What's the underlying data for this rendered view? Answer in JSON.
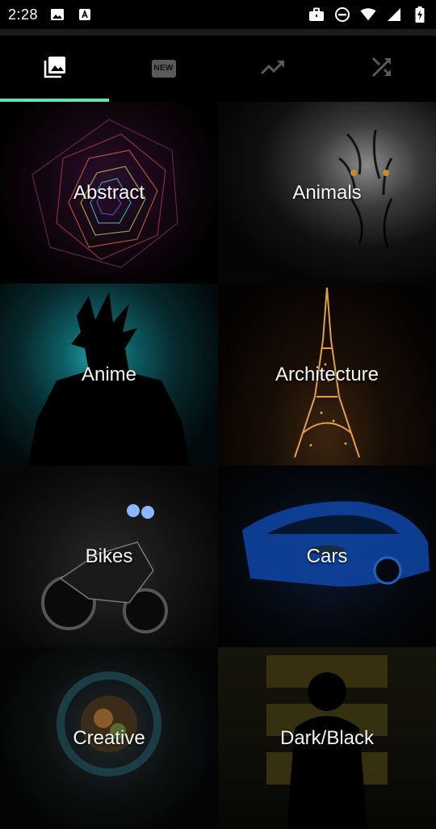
{
  "status_bar": {
    "time": "2:28",
    "icons": [
      "image-notification-icon",
      "a-notification-icon",
      "briefcase-icon",
      "do-not-disturb-icon",
      "wifi-icon",
      "cell-signal-icon",
      "battery-charging-icon"
    ]
  },
  "tabs": [
    {
      "name": "gallery-icon",
      "active": true
    },
    {
      "name": "new-icon",
      "active": false,
      "badge_text": "NEW"
    },
    {
      "name": "trending-icon",
      "active": false
    },
    {
      "name": "shuffle-icon",
      "active": false
    }
  ],
  "accent_color": "#5fe3b7",
  "categories": [
    {
      "label": "Abstract"
    },
    {
      "label": "Animals"
    },
    {
      "label": "Anime"
    },
    {
      "label": "Architecture"
    },
    {
      "label": "Bikes"
    },
    {
      "label": "Cars"
    },
    {
      "label": "Creative"
    },
    {
      "label": "Dark/Black"
    }
  ]
}
